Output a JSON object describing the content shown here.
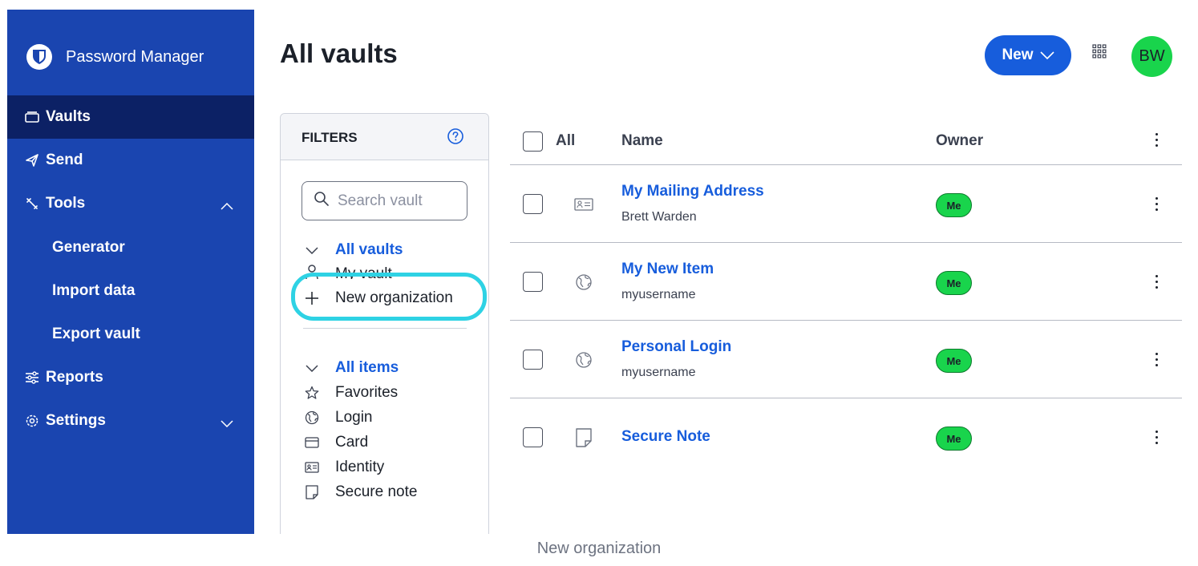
{
  "app": {
    "name": "Password Manager"
  },
  "sidebar": {
    "items": [
      {
        "label": "Vaults",
        "icon": "vault-icon",
        "active": true
      },
      {
        "label": "Send",
        "icon": "send-icon"
      },
      {
        "label": "Tools",
        "icon": "tools-icon",
        "expanded": true
      },
      {
        "label": "Generator"
      },
      {
        "label": "Import data"
      },
      {
        "label": "Export vault"
      },
      {
        "label": "Reports",
        "icon": "sliders-icon"
      },
      {
        "label": "Settings",
        "icon": "gear-icon",
        "expanded": false
      }
    ]
  },
  "header": {
    "title": "All vaults",
    "new_label": "New",
    "avatar_initials": "BW"
  },
  "filters": {
    "title": "FILTERS",
    "search_placeholder": "Search vault",
    "vaults": {
      "all_label": "All vaults",
      "my_vault": "My vault",
      "new_org": "New organization"
    },
    "types": {
      "all_label": "All items",
      "favorites": "Favorites",
      "login": "Login",
      "card": "Card",
      "identity": "Identity",
      "secure_note": "Secure note"
    }
  },
  "table": {
    "headers": {
      "all": "All",
      "name": "Name",
      "owner": "Owner"
    },
    "rows": [
      {
        "name": "My Mailing Address",
        "sub": "Brett Warden",
        "type_icon": "identity-icon",
        "owner": "Me"
      },
      {
        "name": "My New Item",
        "sub": "myusername",
        "type_icon": "globe-icon",
        "owner": "Me"
      },
      {
        "name": "Personal Login",
        "sub": "myusername",
        "type_icon": "globe-icon",
        "owner": "Me"
      },
      {
        "name": "Secure Note",
        "sub": "",
        "type_icon": "note-icon",
        "owner": "Me"
      }
    ]
  },
  "caption": "New organization",
  "colors": {
    "sidebar": "#1a45b0",
    "sidebar_active": "#0c2165",
    "primary": "#175ddc",
    "owner_badge": "#19d44c",
    "highlight": "#2ed2e4"
  }
}
